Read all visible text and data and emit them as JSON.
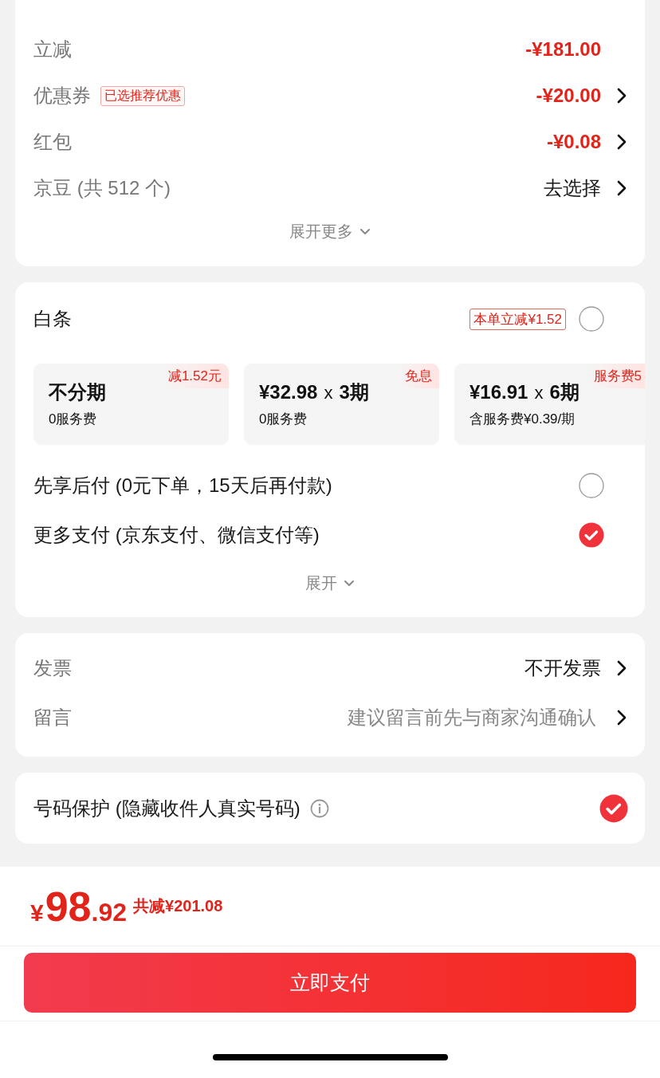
{
  "fee_summary": {
    "rows": [
      {
        "kind": "discount",
        "label": "立减",
        "value": "-¥181.00",
        "chevron": false
      },
      {
        "kind": "discount",
        "label": "优惠券",
        "tag": "已选推荐优惠",
        "value": "-¥20.00",
        "chevron": true
      },
      {
        "kind": "discount",
        "label": "红包",
        "value": "-¥0.08",
        "chevron": true
      },
      {
        "kind": "plain",
        "label": "京豆 (共 512 个)",
        "value": "去选择",
        "chevron": true
      }
    ],
    "expand": "展开更多"
  },
  "payment": {
    "baitiao": {
      "label": "白条",
      "promo": "本单立减¥1.52",
      "selected": false
    },
    "plans": [
      {
        "badge": "减1.52元",
        "title": "不分期",
        "subtitle": "0服务费"
      },
      {
        "badge": "免息",
        "amount": "¥32.98",
        "multiplier": "x",
        "term": "3期",
        "subtitle": "0服务费"
      },
      {
        "badge": "服务费5",
        "amount": "¥16.91",
        "multiplier": "x",
        "term": "6期",
        "subtitle": "含服务费¥0.39/期"
      }
    ],
    "options": [
      {
        "label": "先享后付 (0元下单，15天后再付款)",
        "selected": false
      },
      {
        "label": "更多支付 (京东支付、微信支付等)",
        "selected": true
      }
    ],
    "expand": "展开"
  },
  "extras": {
    "rows": [
      {
        "label": "发票",
        "value": "不开发票"
      },
      {
        "label": "留言",
        "placeholder": "建议留言前先与商家沟通确认"
      }
    ]
  },
  "number_protection": {
    "label": "号码保护 (隐藏收件人真实号码)",
    "checked": true
  },
  "checkout": {
    "currency": "¥",
    "integer": "98",
    "decimal": ".92",
    "saving": "共减¥201.08",
    "pay_button": "立即支付"
  }
}
